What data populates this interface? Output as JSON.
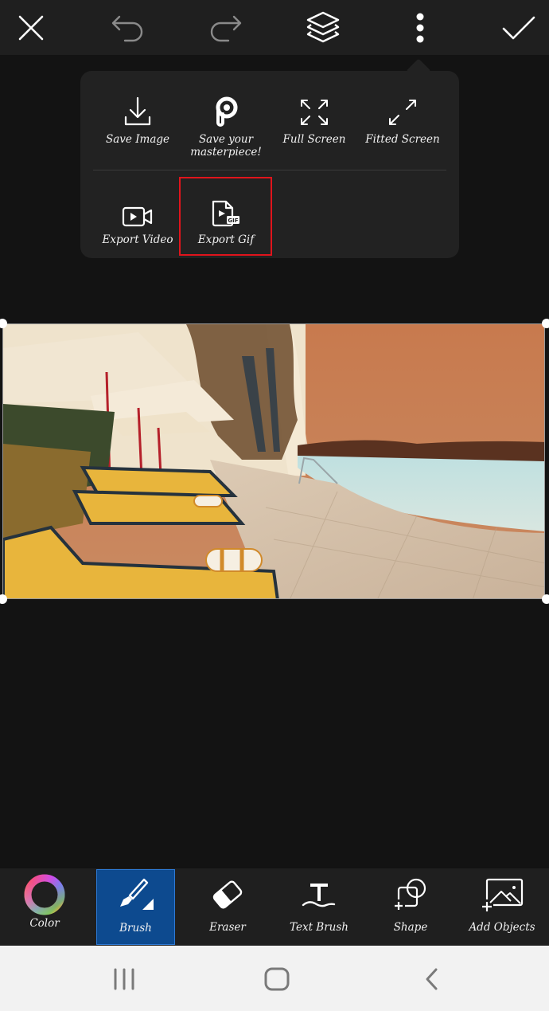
{
  "topbar": {
    "close_icon": "close-icon",
    "undo_icon": "undo-icon",
    "redo_icon": "redo-icon",
    "layers_icon": "layers-icon",
    "more_icon": "more-vertical-icon",
    "apply_icon": "checkmark-icon"
  },
  "menu": {
    "items": [
      {
        "label": "Save Image",
        "icon": "download-icon"
      },
      {
        "label": "Save your masterpiece!",
        "icon": "picsart-logo-icon"
      },
      {
        "label": "Full Screen",
        "icon": "fullscreen-icon"
      },
      {
        "label": "Fitted Screen",
        "icon": "fit-screen-icon"
      },
      {
        "label": "Export Video",
        "icon": "video-camera-icon"
      },
      {
        "label": "Export Gif",
        "icon": "gif-file-icon"
      }
    ],
    "highlighted_item": "Export Gif",
    "highlight_color": "#e0141c"
  },
  "canvas": {
    "content": "artistic filtered photo of poolside lounge chairs with umbrellas, palm trees and sea"
  },
  "tools": {
    "items": [
      {
        "label": "Color",
        "icon": "color-wheel-icon"
      },
      {
        "label": "Brush",
        "icon": "brush-icon"
      },
      {
        "label": "Eraser",
        "icon": "eraser-icon"
      },
      {
        "label": "Text Brush",
        "icon": "text-brush-icon"
      },
      {
        "label": "Shape",
        "icon": "shape-icon"
      },
      {
        "label": "Add Objects",
        "icon": "add-image-icon"
      }
    ],
    "active": "Brush",
    "active_color": "#0d4a8f"
  },
  "navbar": {
    "recents_icon": "recent-apps-icon",
    "home_icon": "home-icon",
    "back_icon": "back-icon"
  }
}
